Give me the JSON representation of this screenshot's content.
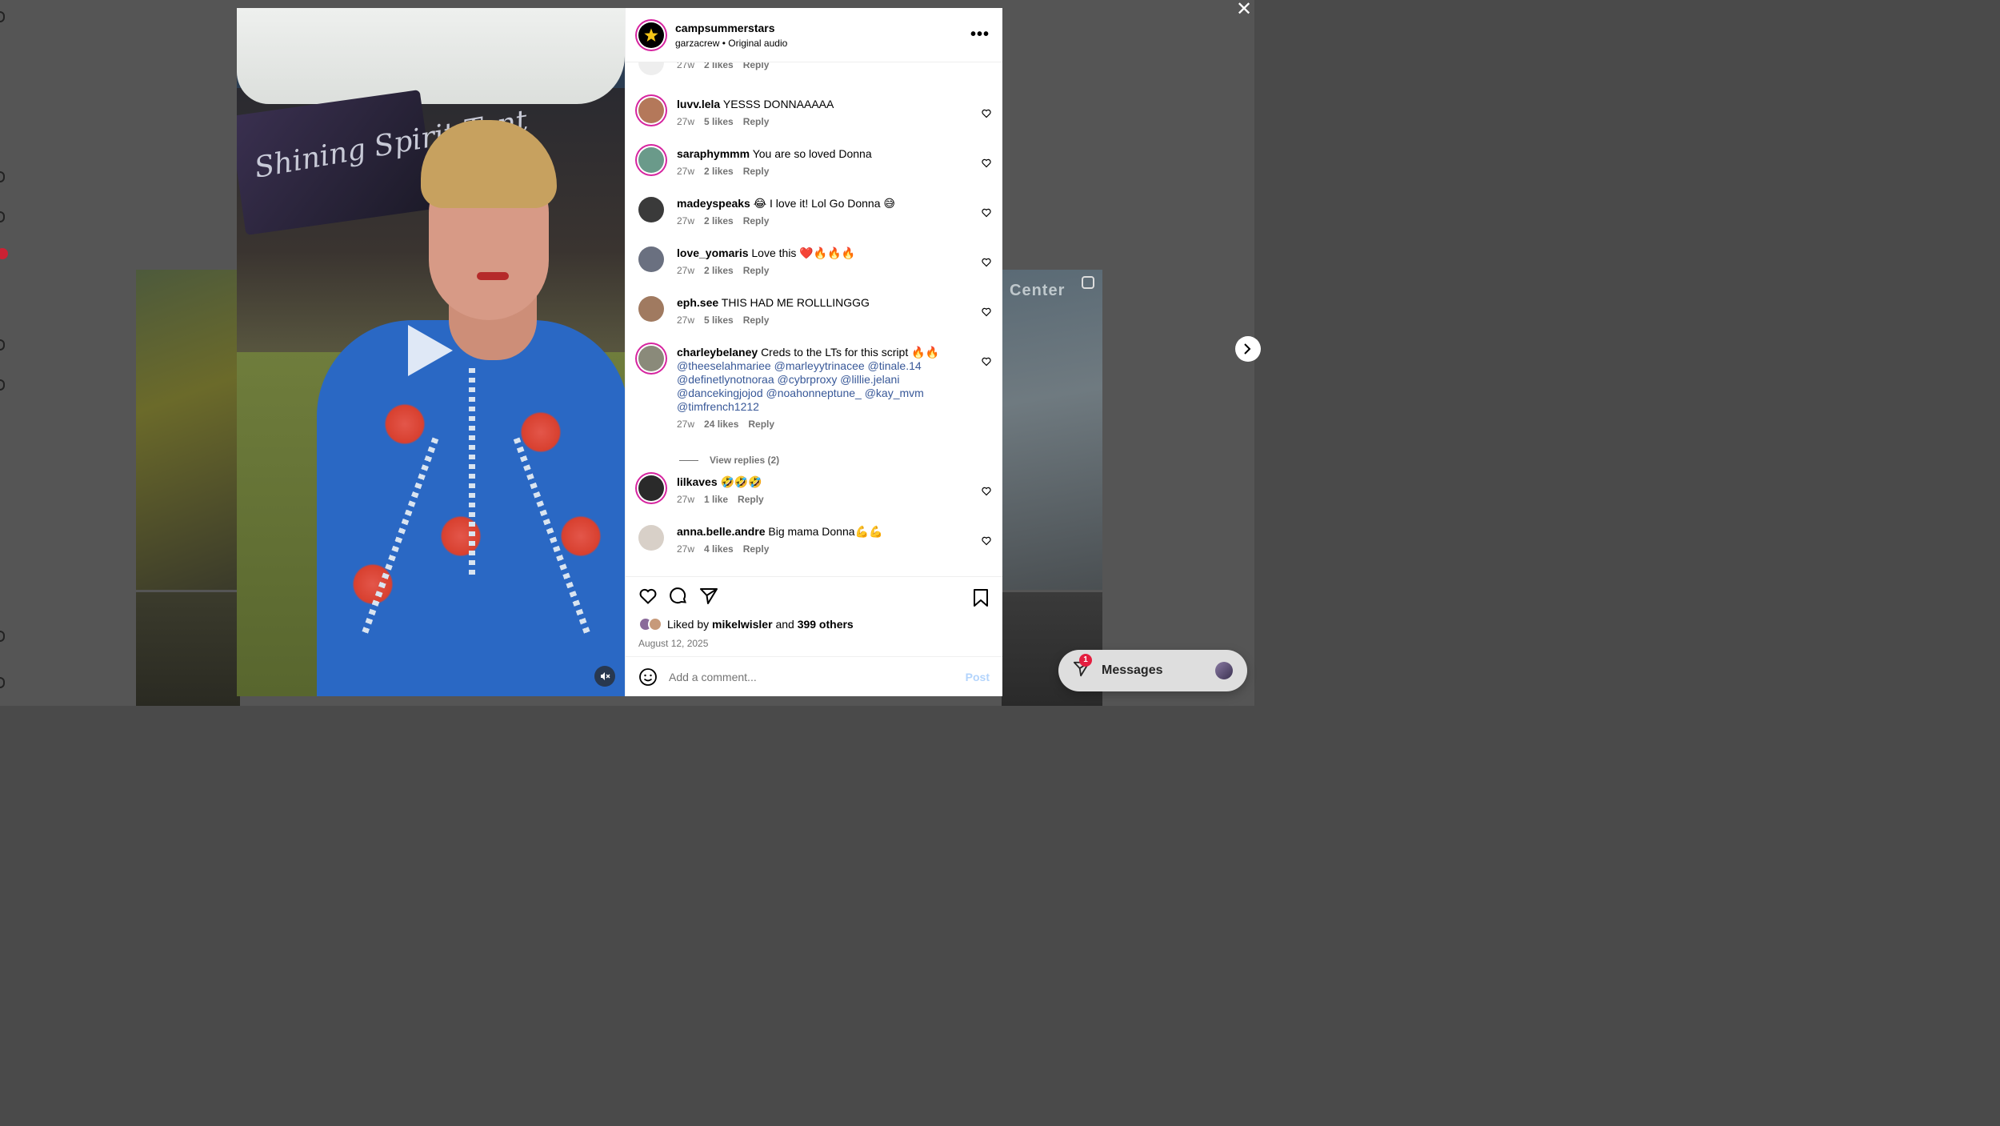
{
  "post": {
    "author": "campsummerstars",
    "collaborator": "garzacrew",
    "separator": "•",
    "audio": "Original audio",
    "more_label": "•••"
  },
  "partial_comment": {
    "time": "27w",
    "likes": "2 likes",
    "reply": "Reply"
  },
  "comments": [
    {
      "user": "luvv.lela",
      "text": "YESSS DONNAAAAA",
      "time": "27w",
      "likes": "5 likes",
      "reply": "Reply",
      "avatar_color": "#b4785a"
    },
    {
      "user": "saraphymmm",
      "text": "You are so loved Donna",
      "time": "27w",
      "likes": "2 likes",
      "reply": "Reply",
      "avatar_color": "#6a9a8a"
    },
    {
      "user": "madeyspeaks",
      "text": "😂 I love it! Lol Go Donna 😅",
      "time": "27w",
      "likes": "2 likes",
      "reply": "Reply",
      "avatar_color": "#3a3a3a"
    },
    {
      "user": "love_yomaris",
      "text": "Love this ❤️🔥🔥🔥",
      "time": "27w",
      "likes": "2 likes",
      "reply": "Reply",
      "avatar_color": "#6a7080"
    },
    {
      "user": "eph.see",
      "text": "THIS HAD ME ROLLLINGGG",
      "time": "27w",
      "likes": "5 likes",
      "reply": "Reply",
      "avatar_color": "#a07a60"
    }
  ],
  "long_comment": {
    "user": "charleybelaney",
    "text": "Creds to the LTs for this script 🔥🔥",
    "mentions_line1": "@theeselahmariee @marleyytrinacee @tinale.14",
    "mentions_line2": "@definetlynotnoraa @cybrproxy @lillie.jelani",
    "mentions_line3": "@dancekingjojod @noahonneptune_ @kay_mvm",
    "mentions_line4": "@timfrench1212",
    "time": "27w",
    "likes": "24 likes",
    "reply": "Reply",
    "view_replies": "View replies (2)",
    "avatar_color": "#8a8a7a"
  },
  "comments2": [
    {
      "user": "lilkaves",
      "text": "🤣🤣🤣",
      "time": "27w",
      "likes": "1 like",
      "reply": "Reply",
      "avatar_color": "#2a2a2a"
    },
    {
      "user": "anna.belle.andre",
      "text": "Big mama Donna💪💪",
      "time": "27w",
      "likes": "4 likes",
      "reply": "Reply",
      "avatar_color": "#d8d0c8"
    }
  ],
  "liked_by": {
    "prefix": "Liked by",
    "user": "mikelwisler",
    "and": "and",
    "others": "399 others"
  },
  "date": "August 12, 2025",
  "comment_input": {
    "placeholder": "Add a comment..."
  },
  "post_button": "Post",
  "messages": {
    "label": "Messages",
    "badge": "1"
  },
  "background": {
    "tile_text": "Center"
  },
  "colors": {
    "link": "#385898",
    "ring": "#d6249f",
    "post_disabled": "#b3d4fc",
    "badge": "#e41e3f"
  }
}
